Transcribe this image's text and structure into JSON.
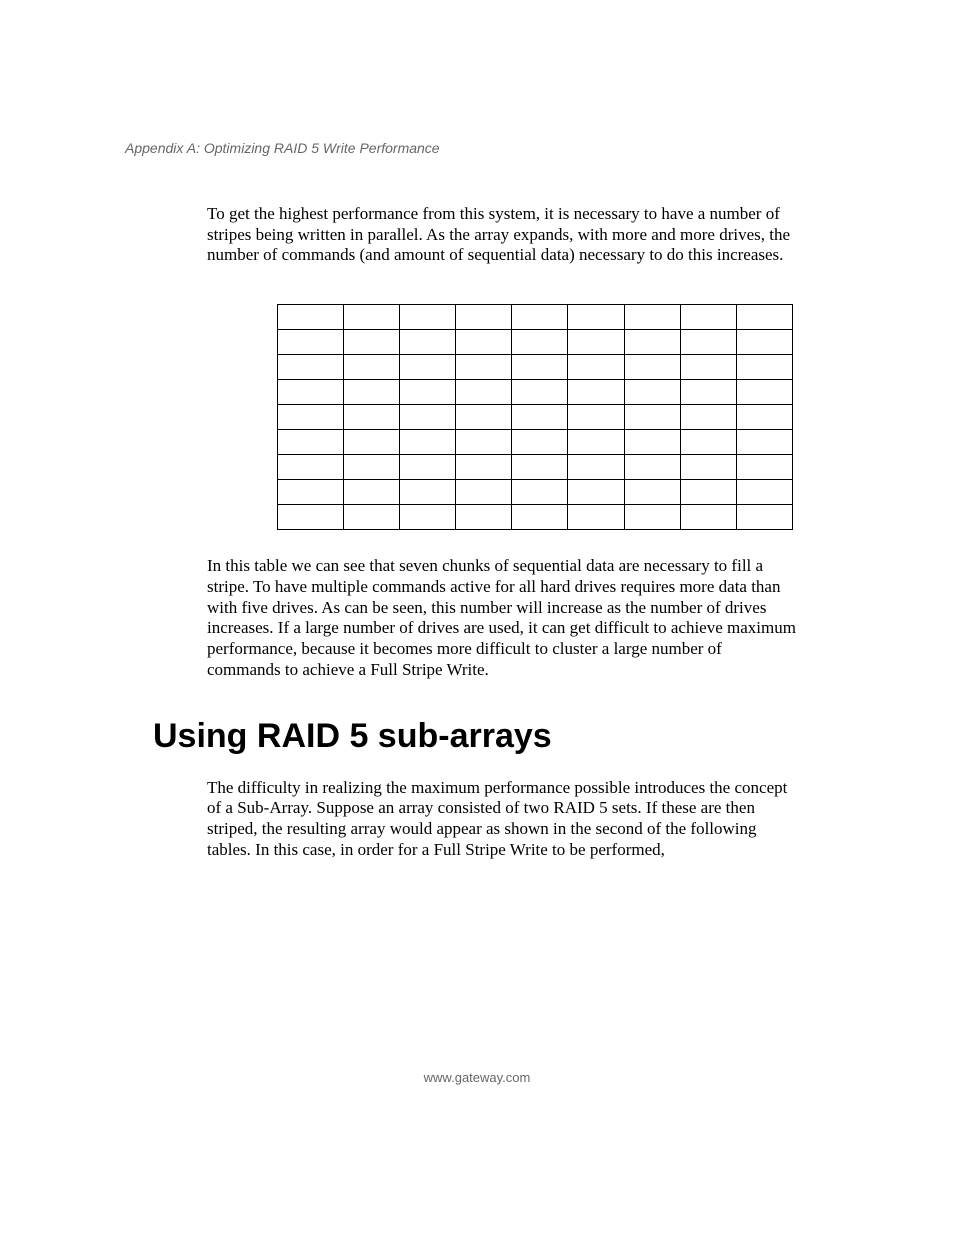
{
  "page": {
    "running_header": "Appendix A: Optimizing RAID 5 Write Performance",
    "paragraph_1": "To get the highest performance from this system, it is necessary to have a number of stripes being written in parallel. As the array expands, with more and more drives, the number of commands (and amount of sequential data) necessary to do this increases.",
    "table": {
      "rows": 9,
      "cols": 9,
      "cells": [
        [
          "",
          "",
          "",
          "",
          "",
          "",
          "",
          "",
          ""
        ],
        [
          "",
          "",
          "",
          "",
          "",
          "",
          "",
          "",
          ""
        ],
        [
          "",
          "",
          "",
          "",
          "",
          "",
          "",
          "",
          ""
        ],
        [
          "",
          "",
          "",
          "",
          "",
          "",
          "",
          "",
          ""
        ],
        [
          "",
          "",
          "",
          "",
          "",
          "",
          "",
          "",
          ""
        ],
        [
          "",
          "",
          "",
          "",
          "",
          "",
          "",
          "",
          ""
        ],
        [
          "",
          "",
          "",
          "",
          "",
          "",
          "",
          "",
          ""
        ],
        [
          "",
          "",
          "",
          "",
          "",
          "",
          "",
          "",
          ""
        ],
        [
          "",
          "",
          "",
          "",
          "",
          "",
          "",
          "",
          ""
        ]
      ]
    },
    "paragraph_2": "In this table we can see that seven chunks of sequential data are necessary to fill a stripe. To have multiple commands active for all hard drives requires more data than with five drives. As can be seen, this number will increase as the number of drives increases. If a large number of drives are used, it can get difficult to achieve maximum performance, because it becomes more difficult to cluster a large number of commands to achieve a Full Stripe Write.",
    "section_heading": "Using RAID 5 sub-arrays",
    "paragraph_3": "The difficulty in realizing the maximum performance possible introduces the concept of a Sub-Array. Suppose an array consisted of two RAID 5 sets. If these are then striped, the resulting array would appear as shown in the second of the following tables. In this case, in order for a Full Stripe Write to be performed,",
    "footer": "www.gateway.com"
  }
}
